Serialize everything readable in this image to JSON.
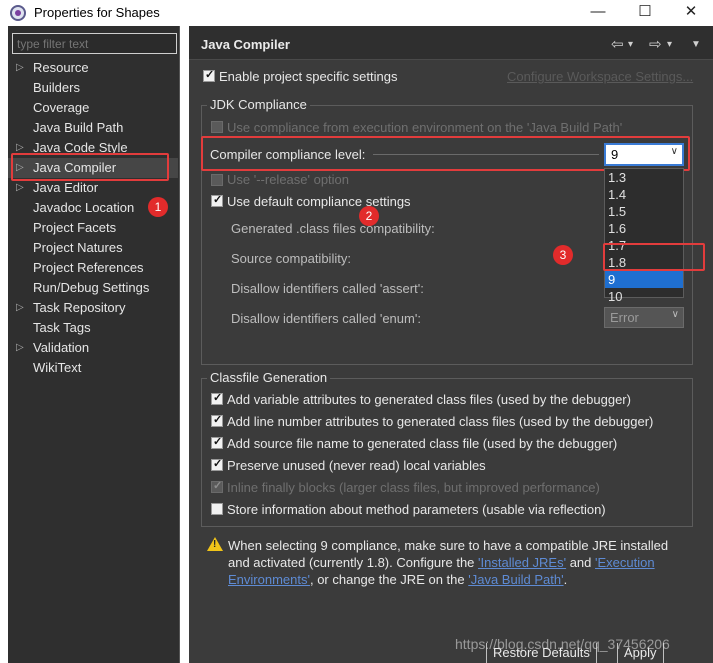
{
  "window": {
    "title": "Properties for Shapes",
    "controls": [
      "—",
      "☐",
      "✕"
    ]
  },
  "filter": {
    "placeholder": "type filter text"
  },
  "tree": {
    "items": [
      {
        "label": "Resource",
        "arrow": true
      },
      {
        "label": "Builders",
        "arrow": false
      },
      {
        "label": "Coverage",
        "arrow": false
      },
      {
        "label": "Java Build Path",
        "arrow": false
      },
      {
        "label": "Java Code Style",
        "arrow": true
      },
      {
        "label": "Java Compiler",
        "arrow": true,
        "selected": true
      },
      {
        "label": "Java Editor",
        "arrow": true
      },
      {
        "label": "Javadoc Location",
        "arrow": false
      },
      {
        "label": "Project Facets",
        "arrow": false
      },
      {
        "label": "Project Natures",
        "arrow": false
      },
      {
        "label": "Project References",
        "arrow": false
      },
      {
        "label": "Run/Debug Settings",
        "arrow": false
      },
      {
        "label": "Task Repository",
        "arrow": true
      },
      {
        "label": "Task Tags",
        "arrow": false
      },
      {
        "label": "Validation",
        "arrow": true
      },
      {
        "label": "WikiText",
        "arrow": false
      }
    ]
  },
  "header": {
    "title": "Java Compiler"
  },
  "settings": {
    "enable_project_specific": "Enable project specific settings",
    "configure_workspace": "Configure Workspace Settings..."
  },
  "jdk": {
    "group_title": "JDK Compliance",
    "use_compliance_from_env": "Use compliance from execution environment on the 'Java Build Path'",
    "compliance_level_label": "Compiler compliance level:",
    "compliance_level_value": "9",
    "use_release": "Use '--release' option",
    "use_default": "Use default compliance settings",
    "generated_class": "Generated .class files compatibility:",
    "source_compat": "Source compatibility:",
    "disallow_assert": "Disallow identifiers called 'assert':",
    "disallow_enum": "Disallow identifiers called 'enum':",
    "enum_value": "Error",
    "dropdown_options": [
      "1.3",
      "1.4",
      "1.5",
      "1.6",
      "1.7",
      "1.8",
      "9",
      "10"
    ],
    "dropdown_selected": "9"
  },
  "classfile": {
    "group_title": "Classfile Generation",
    "items": [
      {
        "label": "Add variable attributes to generated class files (used by the debugger)",
        "checked": true,
        "disabled": false
      },
      {
        "label": "Add line number attributes to generated class files (used by the debugger)",
        "checked": true,
        "disabled": false
      },
      {
        "label": "Add source file name to generated class file (used by the debugger)",
        "checked": true,
        "disabled": false
      },
      {
        "label": "Preserve unused (never read) local variables",
        "checked": true,
        "disabled": false
      },
      {
        "label": "Inline finally blocks (larger class files, but improved performance)",
        "checked": true,
        "disabled": true
      },
      {
        "label": "Store information about method parameters (usable via reflection)",
        "checked": false,
        "disabled": false
      }
    ]
  },
  "warning": {
    "line1": "When selecting 9 compliance, make sure to have a compatible JRE installed",
    "line2_pre": "and activated (currently 1.8). Configure the ",
    "link_installed_jres": "'Installed JREs'",
    "line2_and": " and ",
    "link_exec_env_1": "'Execution",
    "link_exec_env_2": "Environments'",
    "line3_mid": ", or change the JRE on the ",
    "link_build_path": "'Java Build Path'",
    "line3_end": "."
  },
  "buttons": {
    "restore_defaults": "Restore Defaults",
    "apply": "Apply"
  },
  "annotations": [
    "1",
    "2",
    "3"
  ],
  "watermark": "https://blog.csdn.net/qq_37456206",
  "colors": {
    "annotation_red": "#e23c3c",
    "selection_blue": "#1f6fd0",
    "link_blue": "#5e8bd4",
    "warning_yellow": "#f0c419"
  }
}
